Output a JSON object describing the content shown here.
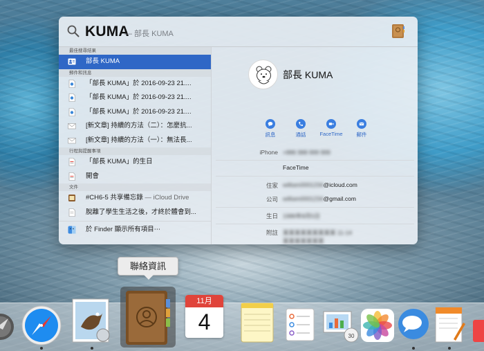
{
  "spotlight": {
    "query": "KUMA",
    "query_hint": "— 部長 KUMA",
    "sections": {
      "top_hit": "最佳搜尋結果",
      "messages": "郵件和訊息",
      "events": "行程與提醒事項",
      "documents": "文件"
    },
    "results": {
      "top_hit": "部長 KUMA",
      "messages": [
        "「部長 KUMA」於 2016-09-23 21....",
        "「部長 KUMA」於 2016-09-23 21....",
        "「部長 KUMA」於 2016-09-23 21....",
        "[新文章] 持續的方法（二）：怎麼抗...",
        "[新文章] 持續的方法（一）：無法長..."
      ],
      "events": [
        "「部長 KUMA」的生日",
        "開會"
      ],
      "documents": [
        "#CH6-5 共享備忘錄",
        "脫離了學生生活之後，才終於體會到..."
      ],
      "documents_suffix": "— iCloud Drive",
      "finder": "於 Finder 顯示所有項目⋯"
    }
  },
  "contact": {
    "name": "部長 KUMA",
    "actions": [
      "訊息",
      "通話",
      "FaceTime",
      "郵件"
    ],
    "fields": {
      "iphone_label": "iPhone",
      "iphone_value": "+886 988 999 999",
      "facetime_value": "FaceTime",
      "home_label": "住家",
      "home_prefix": "william0001234",
      "home_suffix": "@icloud.com",
      "work_label": "公司",
      "work_prefix": "william0001234",
      "work_suffix": "@gmail.com",
      "birthday_label": "生日",
      "birthday_value": "1986年8月5日",
      "note_label": "附註",
      "note_lines": [
        "某某某某某某某某某 11-14",
        "某某某某某某某",
        "某某某某某某某",
        "某某某某"
      ]
    }
  },
  "tooltip": "聯絡資訊",
  "dock": {
    "icons": [
      "launchpad",
      "safari",
      "mail",
      "contacts",
      "calendar",
      "notes",
      "reminders",
      "keynote",
      "photos",
      "messages",
      "pages",
      "other"
    ],
    "calendar_month": "11月",
    "calendar_day": "4"
  },
  "colors": {
    "selection": "#2f67c6",
    "accent": "#3a7ee0"
  }
}
